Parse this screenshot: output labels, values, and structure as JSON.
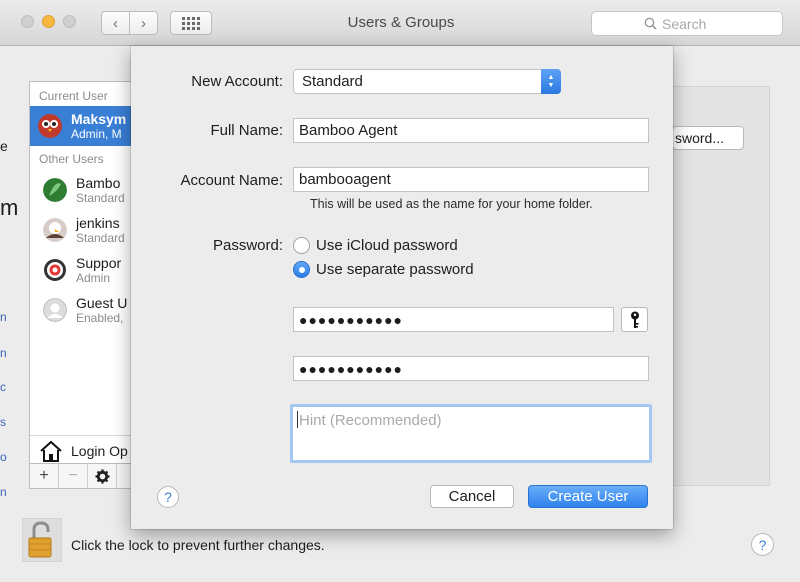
{
  "window": {
    "title": "Users & Groups",
    "search_placeholder": "Search",
    "back_icon": "‹",
    "forward_icon": "›"
  },
  "sidebar": {
    "current_user_header": "Current User",
    "other_users_header": "Other Users",
    "users": [
      {
        "name": "Maksym",
        "role": "Admin, M"
      },
      {
        "name": "Bambo",
        "role": "Standard"
      },
      {
        "name": "jenkins",
        "role": "Standard"
      },
      {
        "name": "Suppor",
        "role": "Admin"
      },
      {
        "name": "Guest U",
        "role": "Enabled,"
      }
    ],
    "login_options": "Login Op",
    "add_label": "+",
    "remove_label": "−",
    "action_label": "✱"
  },
  "background": {
    "password_button": "sword...",
    "lock_text": "Click the lock to prevent further changes.",
    "help_label": "?",
    "left_edge_chars": [
      "e",
      "m",
      "n",
      "n",
      "c",
      "s",
      "o",
      "n",
      "e"
    ]
  },
  "sheet": {
    "new_account_label": "New Account:",
    "new_account_value": "Standard",
    "full_name_label": "Full Name:",
    "full_name_value": "Bamboo Agent",
    "account_name_label": "Account Name:",
    "account_name_value": "bambooagent",
    "account_name_note": "This will be used as the name for your home folder.",
    "password_label": "Password:",
    "radio_icloud": "Use iCloud password",
    "radio_separate": "Use separate password",
    "password_value": "●●●●●●●●●●●",
    "verify_value": "●●●●●●●●●●●",
    "hint_placeholder": "Hint (Recommended)",
    "cancel_label": "Cancel",
    "create_label": "Create User",
    "help_label": "?"
  },
  "colors": {
    "accent": "#3a7fd6",
    "selection": "#3a7fd6",
    "window_bg": "#ececec"
  }
}
